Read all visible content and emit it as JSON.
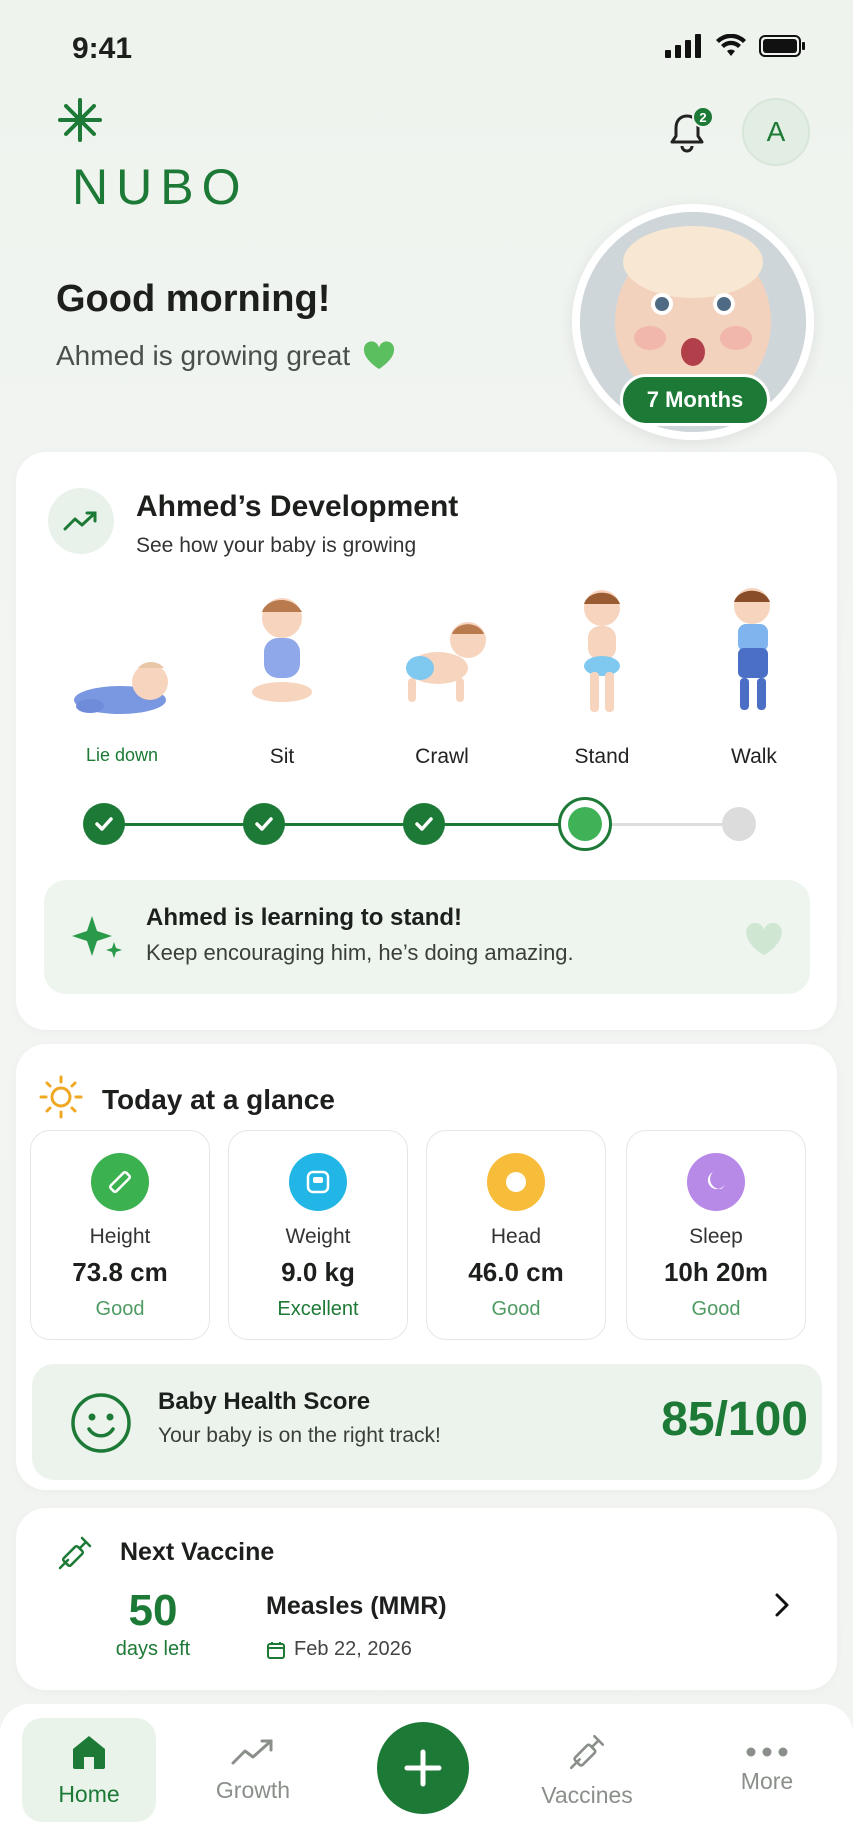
{
  "status_bar": {
    "time": "9:41"
  },
  "header": {
    "logo_text": "NUBO",
    "notification_count": "2",
    "avatar_initial": "A"
  },
  "greeting": {
    "title": "Good morning!",
    "subtitle": "Ahmed is growing great",
    "age_badge": "7 Months"
  },
  "development": {
    "title": "Ahmed’s Development",
    "subtitle": "See how your baby is growing",
    "stages": [
      {
        "label": "Lie down",
        "state": "done"
      },
      {
        "label": "Sit",
        "state": "done"
      },
      {
        "label": "Crawl",
        "state": "done"
      },
      {
        "label": "Stand",
        "state": "current"
      },
      {
        "label": "Walk",
        "state": "future"
      }
    ],
    "learning_title": "Ahmed is learning to stand!",
    "learning_sub": "Keep encouraging him, he’s doing amazing."
  },
  "glance": {
    "title": "Today at a glance",
    "metrics": [
      {
        "name": "Height",
        "value": "73.8 cm",
        "status": "Good",
        "color": "#3bb24f"
      },
      {
        "name": "Weight",
        "value": "9.0 kg",
        "status": "Excellent",
        "color": "#22b6e6"
      },
      {
        "name": "Head",
        "value": "46.0 cm",
        "status": "Good",
        "color": "#f6bc3a"
      },
      {
        "name": "Sleep",
        "value": "10h 20m",
        "status": "Good",
        "color": "#b88ae8"
      }
    ],
    "score_title": "Baby Health Score",
    "score_sub": "Your baby is on the right track!",
    "score_value": "85/100"
  },
  "vaccine": {
    "title": "Next Vaccine",
    "days": "50",
    "days_label": "days left",
    "name": "Measles (MMR)",
    "date": "Feb 22, 2026"
  },
  "nav": {
    "home": "Home",
    "growth": "Growth",
    "vaccines": "Vaccines",
    "more": "More"
  },
  "colors": {
    "brand": "#1d7a36",
    "accent": "#3fb257"
  }
}
